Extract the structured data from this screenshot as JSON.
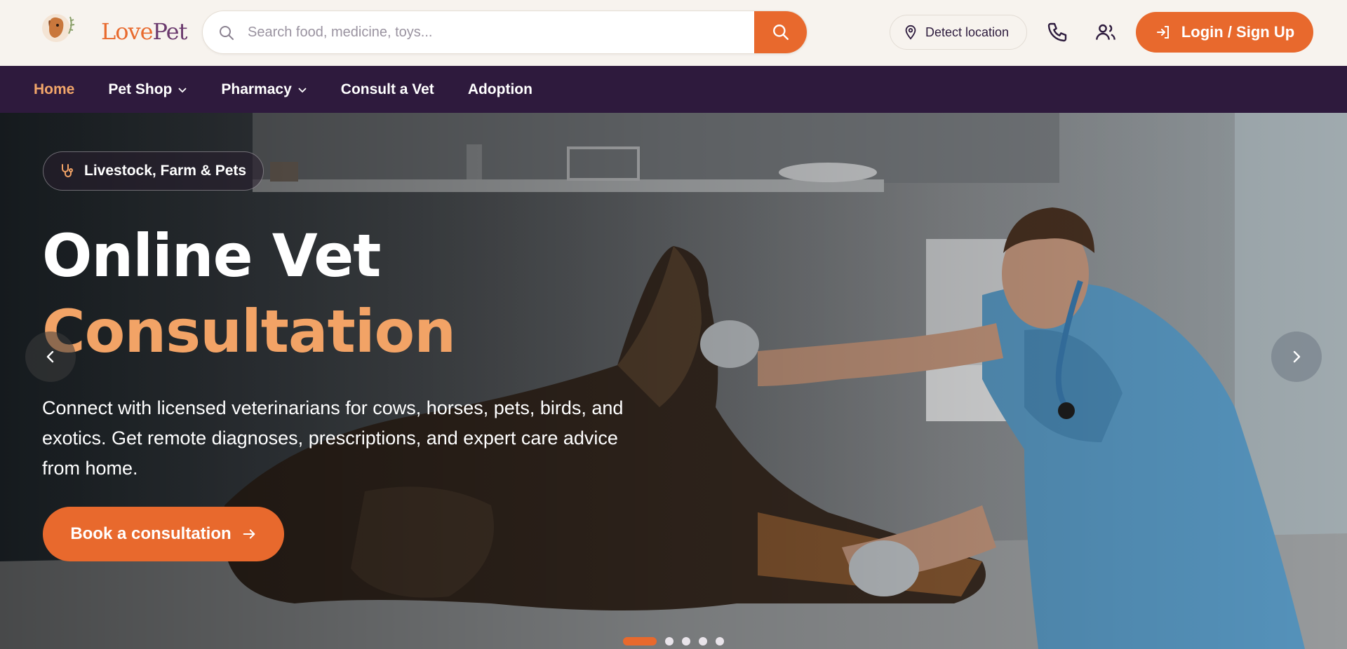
{
  "brand": {
    "name_part1": "Lov",
    "name_part2": "e",
    "name_part3": "Pet"
  },
  "search": {
    "placeholder": "Search food, medicine, toys..."
  },
  "header": {
    "location_label": "Detect location",
    "login_label": "Login / Sign Up"
  },
  "nav": {
    "items": [
      {
        "label": "Home",
        "active": true
      },
      {
        "label": "Pet Shop",
        "dropdown": true
      },
      {
        "label": "Pharmacy",
        "dropdown": true
      },
      {
        "label": "Consult a Vet"
      },
      {
        "label": "Adoption"
      }
    ]
  },
  "hero": {
    "badge": "Livestock, Farm & Pets",
    "title_line1": "Online Vet",
    "title_line2": "Consultation",
    "description": "Connect with licensed veterinarians for cows, horses, pets, birds, and exotics. Get remote diagnoses, prescriptions, and expert care advice from home.",
    "cta_label": "Book a consultation",
    "slide_count": 5,
    "active_slide": 1
  },
  "colors": {
    "accent": "#e8692d",
    "nav_bg": "#2e1a3d",
    "highlight": "#f2a366"
  }
}
